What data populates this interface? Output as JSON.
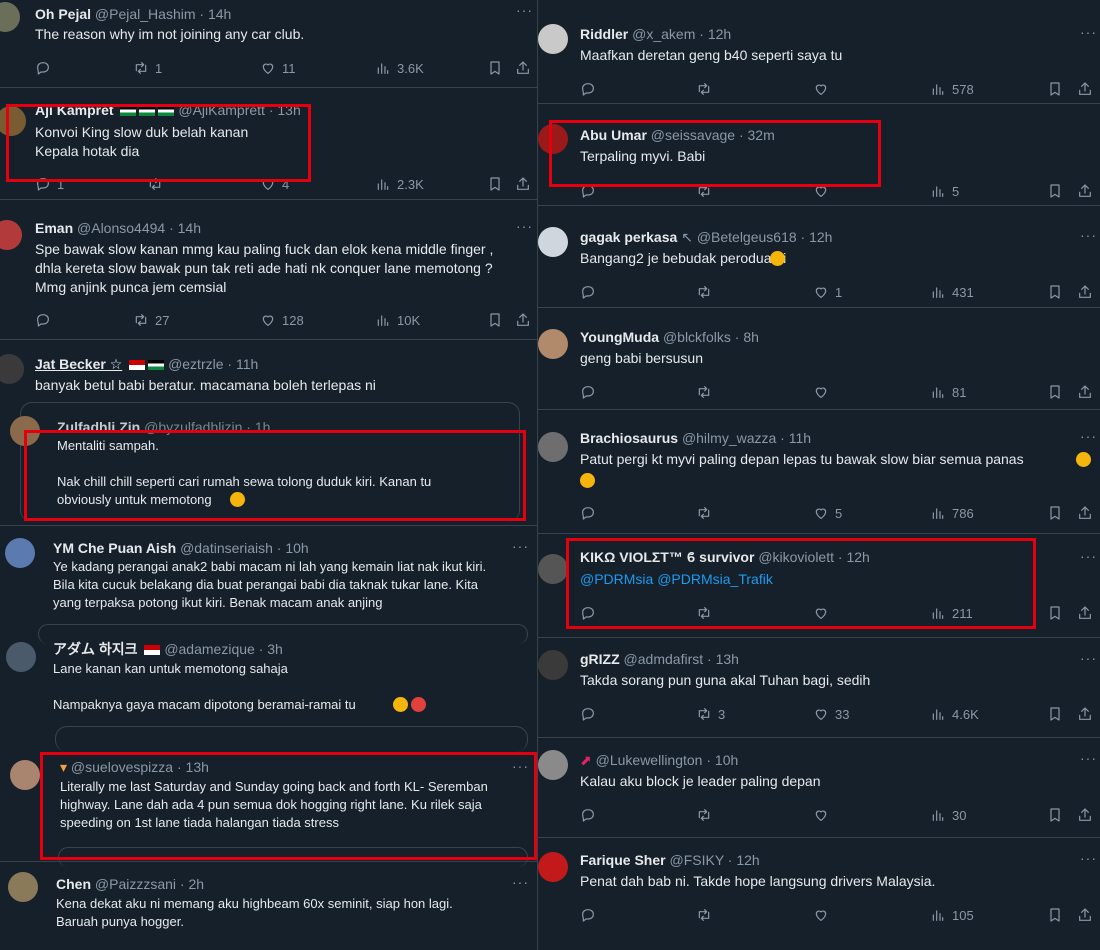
{
  "left": [
    {
      "name": "Oh Pejal",
      "handle": "@Pejal_Hashim",
      "time": "14h",
      "text": "The reason why im not joining any car club.",
      "reply": "",
      "retweet": "1",
      "like": "11",
      "views": "3.6K"
    },
    {
      "name": "Aji Kampret",
      "handle": "@AjiKamprett",
      "time": "13h",
      "text": "Konvoi King slow duk belah kanan\nKepala hotak dia",
      "reply": "1",
      "retweet": "",
      "like": "4",
      "views": "2.3K"
    },
    {
      "name": "Eman",
      "handle": "@Alonso4494",
      "time": "14h",
      "text": "Spe bawak slow kanan mmg kau paling fuck dan elok kena middle finger ,\ndhla kereta slow bawak pun tak reti ade hati nk conquer lane memotong ?\nMmg anjink punca jem cemsial",
      "reply": "",
      "retweet": "27",
      "like": "128",
      "views": "10K"
    },
    {
      "name": "Jat Becker ☆",
      "handle": "@eztrzle",
      "time": "11h",
      "text": "banyak betul babi beratur. macamana boleh terlepas ni"
    },
    {
      "name": "Zulfadhli Zin",
      "handle": "@byzulfadhlizin",
      "time": "1h",
      "text": "Mentaliti sampah.\n\nNak chill chill seperti cari rumah sewa tolong duduk kiri. Kanan tu\nobviously untuk memotong"
    },
    {
      "name": "YM Che Puan Aish",
      "handle": "@datinseriaish",
      "time": "10h",
      "text": "Ye kadang perangai anak2 babi macam ni lah yang kemain liat nak ikut kiri.\nBila kita cucuk belakang dia buat perangai babi dia taknak tukar lane. Kita\nyang terpaksa potong ikut kiri. Benak macam anak anjing"
    },
    {
      "name": "アダム 하지크",
      "handle": "@adamezique",
      "time": "3h",
      "text": "Lane kanan kan untuk memotong sahaja\n\nNampaknya gaya macam dipotong beramai-ramai tu"
    },
    {
      "name": "",
      "handle": "@suelovespizza",
      "time": "13h",
      "text": "Literally me last Saturday and Sunday going back and forth KL- Seremban\nhighway. Lane dah ada 4 pun semua dok hogging right lane. Ku rilek saja\nspeeding on 1st lane tiada halangan tiada stress"
    },
    {
      "name": "Chen",
      "handle": "@Paizzzsani",
      "time": "2h",
      "text": "Kena dekat aku ni memang aku highbeam 60x seminit, siap hon lagi.\nBaruah punya hogger."
    }
  ],
  "right": [
    {
      "name": "Riddler",
      "handle": "@x_akem",
      "time": "12h",
      "text": "Maafkan deretan geng b40 seperti saya tu",
      "reply": "",
      "retweet": "",
      "like": "",
      "views": "578"
    },
    {
      "name": "Abu Umar",
      "handle": "@seissavage",
      "time": "32m",
      "text": "Terpaling myvi. Babi",
      "reply": "",
      "retweet": "",
      "like": "",
      "views": "5"
    },
    {
      "name": "gagak perkasa",
      "handle": "@Betelgeus618",
      "time": "12h",
      "text": "Bangang2 je bebudak perodua ni",
      "reply": "",
      "retweet": "",
      "like": "1",
      "views": "431"
    },
    {
      "name": "YoungMuda",
      "handle": "@blckfolks",
      "time": "8h",
      "text": "geng babi bersusun",
      "reply": "",
      "retweet": "",
      "like": "",
      "views": "81"
    },
    {
      "name": "Brachiosaurus",
      "handle": "@hilmy_wazza",
      "time": "11h",
      "text": "Patut pergi kt myvi paling depan lepas tu bawak slow biar semua panas",
      "reply": "",
      "retweet": "",
      "like": "5",
      "views": "786"
    },
    {
      "name": "KIKΩ VIOLΣT™ ϐ survivor",
      "handle": "@kikoviolett",
      "time": "12h",
      "text": "@PDRMsia @PDRMsia_Trafik",
      "reply": "",
      "retweet": "",
      "like": "",
      "views": "211"
    },
    {
      "name": "gRIZZ",
      "handle": "@admdafirst",
      "time": "13h",
      "text": "Takda sorang pun guna akal Tuhan bagi, sedih",
      "reply": "",
      "retweet": "3",
      "like": "33",
      "views": "4.6K"
    },
    {
      "name": "",
      "handle": "@Lukewellington",
      "time": "10h",
      "text": "Kalau aku block je leader paling depan",
      "reply": "",
      "retweet": "",
      "like": "",
      "views": "30"
    },
    {
      "name": "Farique Sher",
      "handle": "@FSIKY",
      "time": "12h",
      "text": "Penat dah bab ni. Takde hope langsung drivers Malaysia.",
      "reply": "",
      "retweet": "",
      "like": "",
      "views": "105"
    }
  ],
  "sep": " · ",
  "colors": {
    "bg": "#15202b",
    "text": "#e7e9ea",
    "muted": "#8b98a5",
    "link": "#1d9bf0",
    "highlight": "#e5000f"
  }
}
